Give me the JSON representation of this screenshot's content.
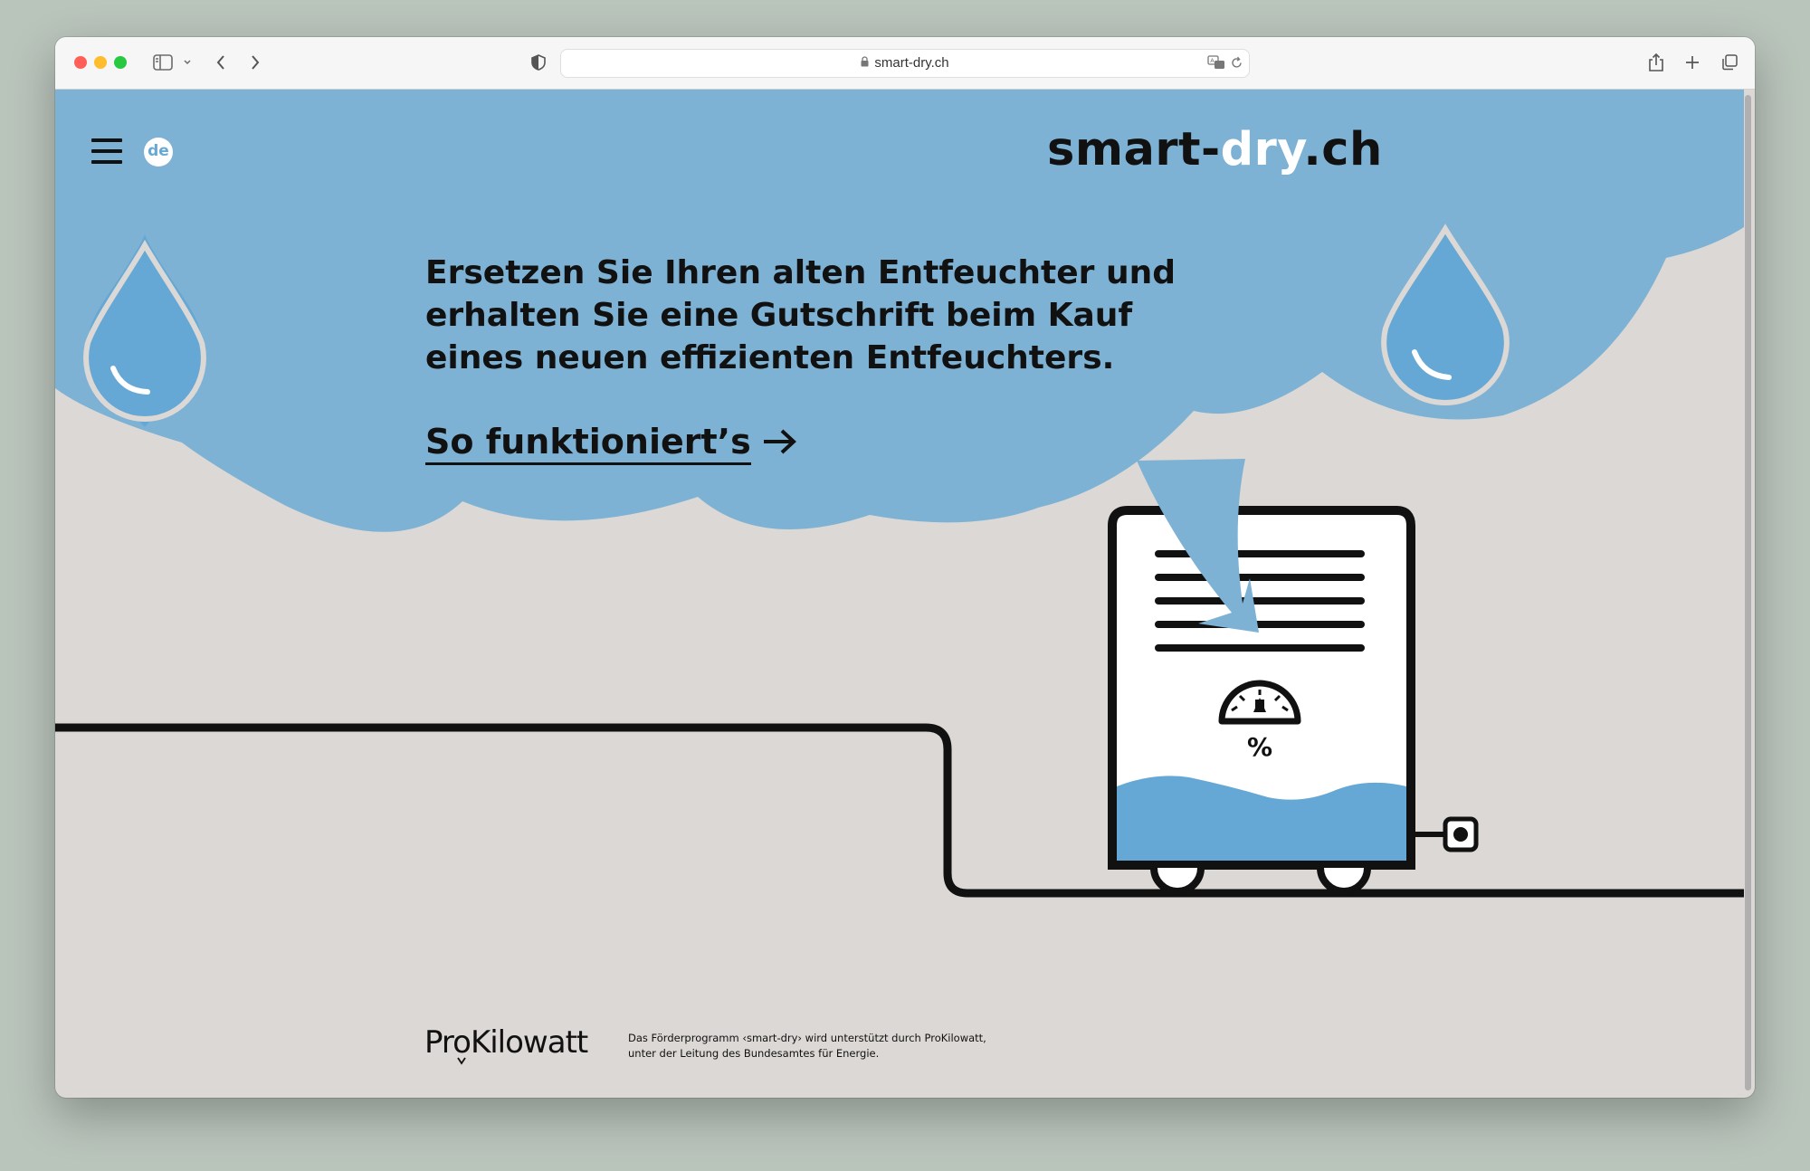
{
  "browser": {
    "url": "smart-dry.ch"
  },
  "header": {
    "language": "de",
    "logo_part1": "smart-",
    "logo_part2": "dry",
    "logo_part3": ".ch"
  },
  "hero": {
    "headline": "Ersetzen Sie Ihren alten Entfeuchter und erhalten Sie eine Gutschrift beim Kauf eines neuen effizienten Entfeuchters.",
    "cta_label": "So funktioniert’s",
    "device_symbol": "%"
  },
  "footer": {
    "sponsor_logo": "ProKilowatt",
    "sponsor_text": "Das Förderprogramm ‹smart-dry› wird unterstützt durch ProKilowatt, unter der Leitung des Bundesamtes für Energie."
  },
  "colors": {
    "cloud_blue": "#7eb2d4",
    "drop_blue": "#65a8d5",
    "background": "#dcd8d5",
    "ink": "#111111"
  },
  "icons": {
    "menu": "hamburger-icon",
    "cta_arrow": "arrow-right-icon",
    "meter": "gauge-icon",
    "socket": "power-socket-icon"
  }
}
